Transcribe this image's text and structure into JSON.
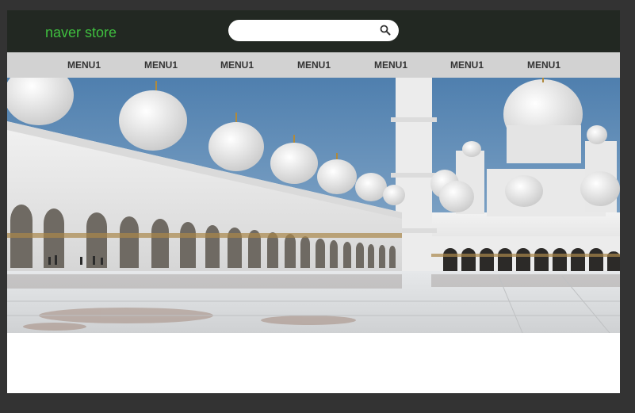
{
  "header": {
    "brand": "naver store",
    "brand_color": "#3fbf3f",
    "background": "#222822",
    "search": {
      "value": "",
      "placeholder": "",
      "icon": "search-icon"
    }
  },
  "nav": {
    "background": "#d2d2d2",
    "items": [
      {
        "label": "MENU1"
      },
      {
        "label": "MENU1"
      },
      {
        "label": "MENU1"
      },
      {
        "label": "MENU1"
      },
      {
        "label": "MENU1"
      },
      {
        "label": "MENU1"
      },
      {
        "label": "MENU1"
      }
    ]
  },
  "hero": {
    "image": "mosque-courtyard-photo"
  }
}
